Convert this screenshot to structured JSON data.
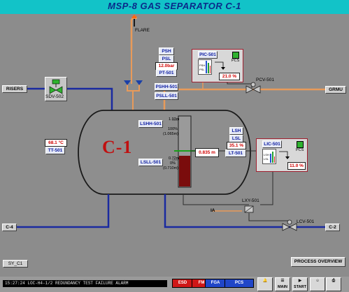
{
  "window": {
    "title": "MSP-8  GAS SEPARATOR C-1"
  },
  "vessel": {
    "label": "C-1"
  },
  "flare": {
    "label": "FLARE"
  },
  "risers": {
    "label": "RISERS"
  },
  "sdv": {
    "label": "SDV-502"
  },
  "pic": {
    "tag": "PIC-501",
    "output_value": "21.0 %",
    "pcs_label": "PCS",
    "psh_tag": "PSH",
    "psl_tag": "PSL",
    "pressure_value": "12.0bar",
    "pt_tag": "PT-501",
    "bar_labels": [
      "PSH",
      "PSL"
    ],
    "pcs_indicator_color": "#2fb22f"
  },
  "pcv": {
    "tag": "PCV-501"
  },
  "grmu": {
    "label": "GRMU"
  },
  "level_switches": {
    "pshh": "PSHH-501",
    "psll": "PSLL-501",
    "lshh": "LSHH-501",
    "lsll": "LSLL-501"
  },
  "level_gauge": {
    "lshh_height": "1.93m",
    "pct_100": "100%",
    "len_100": "(1.065m)",
    "lsll_height": "0.72m",
    "pct_0": "0%",
    "len_0": "(0.710m)",
    "level_value": "0.835 m",
    "fill_fraction": 0.44
  },
  "temperature": {
    "value": "68.1 °C",
    "tag": "TT-501"
  },
  "lic": {
    "tag": "LIC-501",
    "output_value": "11.0 %",
    "pcs_label": "PCS",
    "lsh_tag": "LSH",
    "lsl_tag": "LSL",
    "level_percent": "35.1 %",
    "lt_tag": "LT-501",
    "bar_labels": [
      "LSH",
      "LSL"
    ]
  },
  "lxy": {
    "tag": "LXY-501"
  },
  "ia": {
    "label": "IA"
  },
  "lcv": {
    "tag": "LCV-501"
  },
  "outlets": {
    "left": "C-4",
    "right": "C-2"
  },
  "bottom": {
    "sy_button": "SY_C1",
    "process_overview": "PROCESS OVERVIEW",
    "alarm_text": "15:27:24 LOC-H4-1/2 REDUNDANCY TEST FAILURE        ALARM",
    "sys_buttons": [
      {
        "label": "ESD",
        "color": "#d01818"
      },
      {
        "label": "FM",
        "color": "#d01818"
      },
      {
        "label": "FGA",
        "color": "#2046c8"
      },
      {
        "label": "PCS",
        "color": "#2046c8"
      }
    ],
    "tools": [
      "MAIN",
      "START"
    ]
  },
  "colors": {
    "gas_line": "#e89a5a",
    "liquid_line": "#1a2aa0",
    "liquid_fill": "#7a0c0c",
    "title_bg": "#12c3c8",
    "title_text": "#0a2a8a"
  }
}
